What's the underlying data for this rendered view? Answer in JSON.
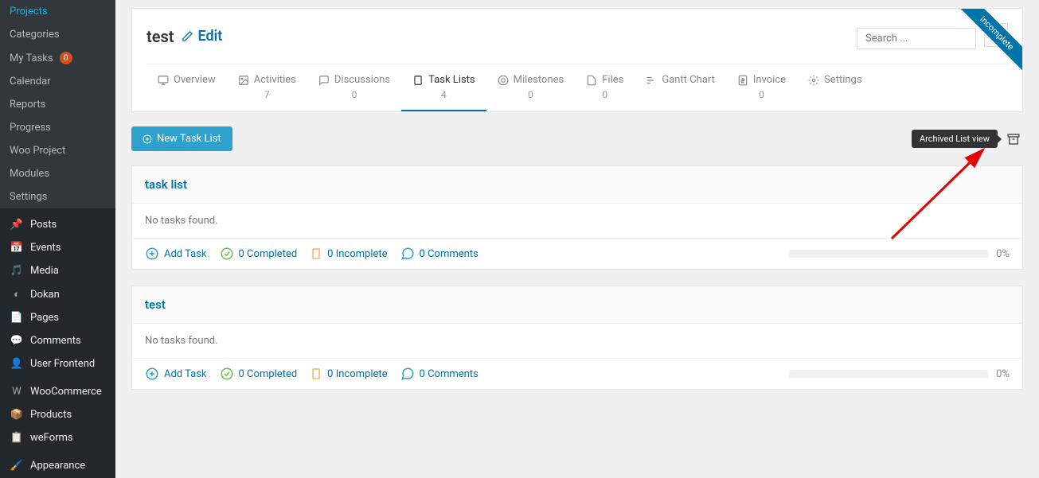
{
  "sidebar": {
    "sub": [
      "Projects",
      "Categories",
      "My Tasks",
      "Calendar",
      "Reports",
      "Progress",
      "Woo Project",
      "Modules",
      "Settings"
    ],
    "mytasks_badge": "0",
    "main": [
      "Posts",
      "Events",
      "Media",
      "Dokan",
      "Pages",
      "Comments",
      "User Frontend",
      "WooCommerce",
      "Products",
      "weForms",
      "Appearance"
    ]
  },
  "header": {
    "title": "test",
    "edit": "Edit",
    "search_placeholder": "Search ...",
    "ribbon": "Incomplete"
  },
  "tabs": [
    {
      "label": "Overview",
      "count": ""
    },
    {
      "label": "Activities",
      "count": "7"
    },
    {
      "label": "Discussions",
      "count": "0"
    },
    {
      "label": "Task Lists",
      "count": "4",
      "active": true
    },
    {
      "label": "Milestones",
      "count": "0"
    },
    {
      "label": "Files",
      "count": "0"
    },
    {
      "label": "Gantt Chart",
      "count": ""
    },
    {
      "label": "Invoice",
      "count": "0"
    },
    {
      "label": "Settings",
      "count": ""
    }
  ],
  "actions": {
    "new_list": "New Task List",
    "tooltip": "Archived List view"
  },
  "lists": [
    {
      "title": "task list",
      "empty": "No tasks found.",
      "add": "Add Task",
      "completed": "0 Completed",
      "incomplete": "0 Incomplete",
      "comments": "0 Comments",
      "pct": "0%"
    },
    {
      "title": "test",
      "empty": "No tasks found.",
      "add": "Add Task",
      "completed": "0 Completed",
      "incomplete": "0 Incomplete",
      "comments": "0 Comments",
      "pct": "0%"
    }
  ]
}
